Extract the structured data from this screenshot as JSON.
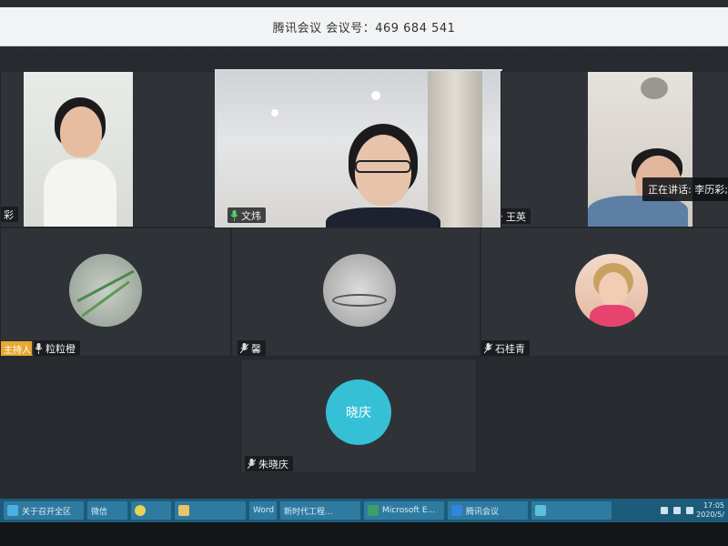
{
  "window": {
    "title": "腾讯会议  会议号：469 684 541"
  },
  "speaking": {
    "text": "正在讲话: 李历彩; 文"
  },
  "participants": [
    {
      "name": "彩",
      "kind": "video"
    },
    {
      "name": "文炜",
      "kind": "video"
    },
    {
      "name": "王英",
      "kind": "video"
    },
    {
      "name": "粒粒橙",
      "kind": "avatar",
      "host_badge": "主持人"
    },
    {
      "name": "馨",
      "kind": "avatar"
    },
    {
      "name": "石桂青",
      "kind": "avatar"
    },
    {
      "name": "朱晓庆",
      "kind": "avatar",
      "avatar_text": "晓庆"
    }
  ],
  "taskbar": {
    "items": [
      {
        "label": "关于召开全区"
      },
      {
        "label": "微信"
      },
      {
        "label": ""
      },
      {
        "label": "Word"
      },
      {
        "label": "新时代工程..."
      },
      {
        "label": "Microsoft E..."
      },
      {
        "label": "腾讯会议"
      },
      {
        "label": ""
      }
    ],
    "clock_time": "17:05",
    "clock_date": "2020/5/"
  },
  "colors": {
    "tile_bg": "#2f3338",
    "stage_bg": "#272b30",
    "avatar_accent": "#36c0d6",
    "host_badge": "#e7a733",
    "taskbar": "#1d5b7a"
  }
}
